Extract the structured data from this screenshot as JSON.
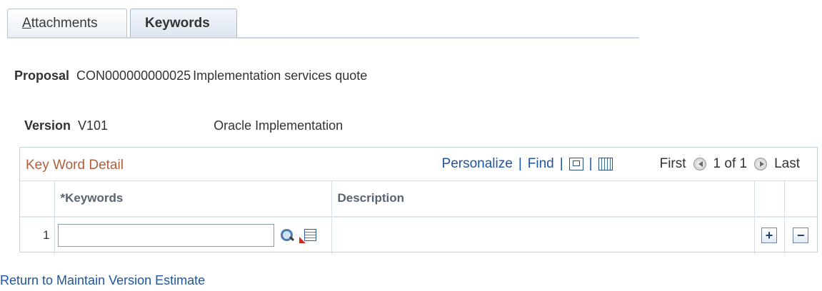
{
  "tabs": {
    "attachments": "Attachments",
    "keywords": "Keywords"
  },
  "proposal": {
    "label": "Proposal",
    "id": "CON000000000025",
    "description": "Implementation services quote"
  },
  "version": {
    "label": "Version",
    "id": "V101",
    "description": "Oracle Implementation"
  },
  "grid": {
    "title": "Key Word Detail",
    "personalize": "Personalize",
    "find": "Find",
    "separator": "|",
    "first": "First",
    "count": "1 of 1",
    "last": "Last",
    "columns": {
      "keywords": "*Keywords",
      "description": "Description"
    },
    "rows": [
      {
        "num": "1",
        "keyword": "",
        "description": ""
      }
    ],
    "add_label": "+",
    "delete_label": "−"
  },
  "icons": {
    "zoom": "zoom-grid-icon",
    "download": "download-spreadsheet-icon",
    "lookup": "lookup-magnifier-icon",
    "prompt": "prompt-list-icon",
    "prev": "previous-arrow-icon",
    "next": "next-arrow-icon"
  },
  "return_link": "Return to Maintain Version Estimate",
  "colors": {
    "link": "#1f55a2",
    "grid_title": "#b0603c",
    "tab_border": "#b8c4d1"
  }
}
